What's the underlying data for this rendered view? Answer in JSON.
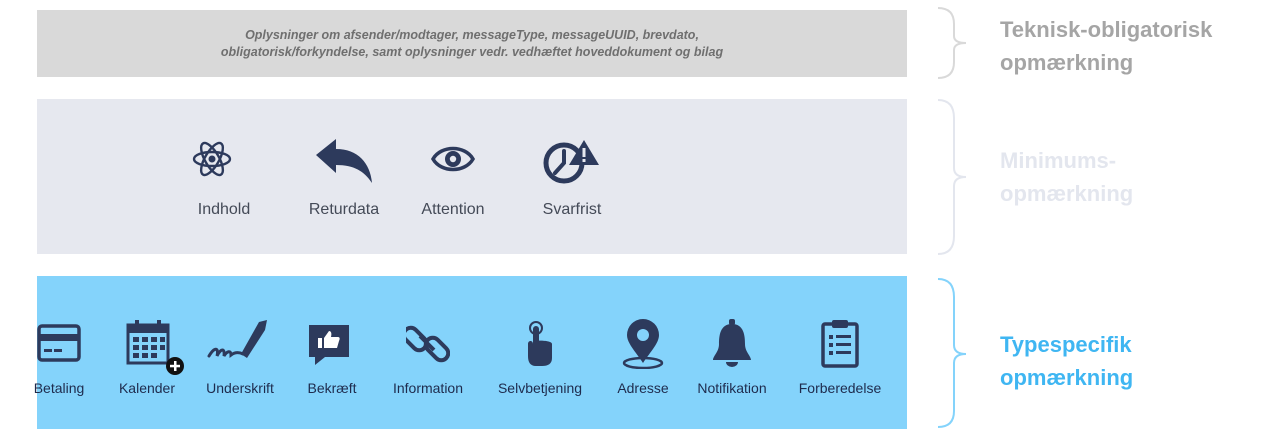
{
  "technical": {
    "line1": "Oplysninger om afsender/modtager, messageType, messageUUID, brevdato,",
    "line2": "obligatorisk/forkyndelse, samt oplysninger vedr. vedhæftet hoveddokument og bilag",
    "side_line1": "Teknisk-obligatorisk",
    "side_line2": "opmærkning",
    "side_color": "#a5a5a5"
  },
  "minimum": {
    "items": [
      {
        "label": "Indhold",
        "icon": "atom-icon"
      },
      {
        "label": "Returdata",
        "icon": "reply-arrow-icon"
      },
      {
        "label": "Attention",
        "icon": "eye-icon"
      },
      {
        "label": "Svarfrist",
        "icon": "clock-warning-icon"
      }
    ],
    "side_line1": "Minimums-",
    "side_line2": "opmærkning",
    "side_color": "#e3e6ee"
  },
  "typespecific": {
    "items": [
      {
        "label": "Betaling",
        "icon": "credit-card-icon"
      },
      {
        "label": "Kalender",
        "icon": "calendar-add-icon"
      },
      {
        "label": "Underskrift",
        "icon": "signature-pen-icon"
      },
      {
        "label": "Bekræft",
        "icon": "thumbs-up-icon"
      },
      {
        "label": "Information",
        "icon": "link-icon"
      },
      {
        "label": "Selvbetjening",
        "icon": "pointing-hand-icon"
      },
      {
        "label": "Adresse",
        "icon": "map-pin-icon"
      },
      {
        "label": "Notifikation",
        "icon": "bell-icon"
      },
      {
        "label": "Forberedelse",
        "icon": "clipboard-icon"
      }
    ],
    "side_line1": "Typespecifik",
    "side_line2": "opmærkning",
    "side_color": "#3fb6f2"
  },
  "colors": {
    "icon_dark": "#2d3a5c",
    "band_grey": "#d9d9d9",
    "band_light": "#e6e8ef",
    "band_blue": "#84d3fb"
  }
}
